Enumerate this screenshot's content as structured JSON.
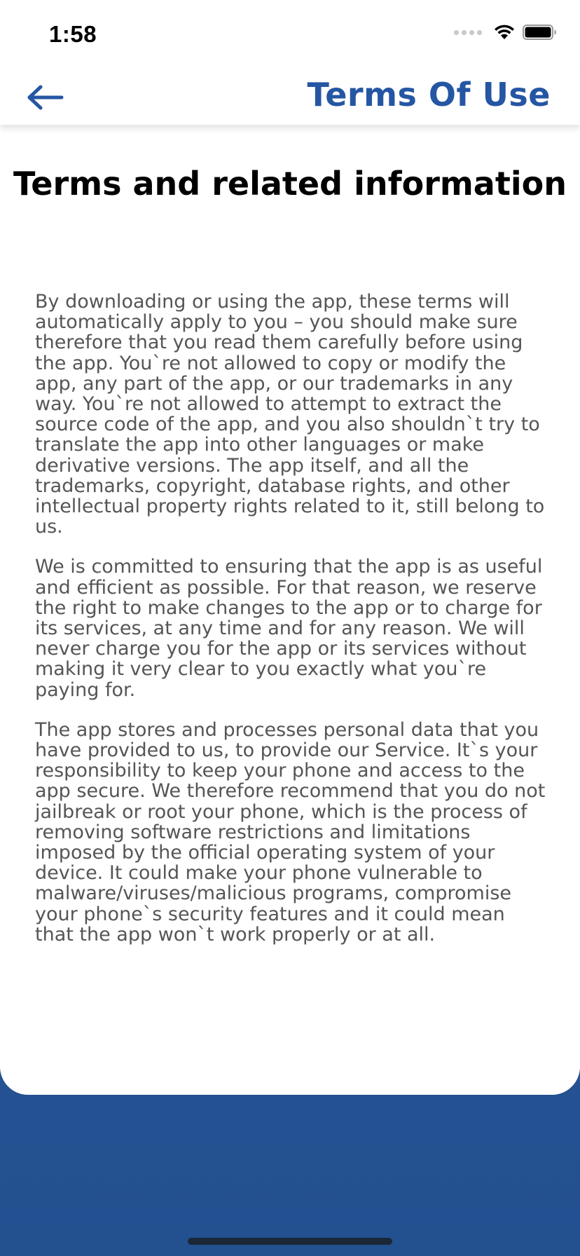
{
  "status_bar": {
    "time": "1:58"
  },
  "nav": {
    "title": "Terms Of Use",
    "back_icon": "arrow-left-icon"
  },
  "content": {
    "heading": "Terms and related information",
    "paragraphs": [
      "By downloading or using the app, these terms will automatically apply to you – you should make sure therefore that you read them carefully before using the app. You`re not allowed to copy or modify the app, any part of the app, or our trademarks in any way. You`re not allowed to attempt to extract the source code of the app, and you also shouldn`t try to translate the app into other languages or make derivative versions. The app itself, and all the trademarks, copyright, database rights, and other intellectual property rights related to it, still belong to us.",
      "We is committed to ensuring that the app is as useful and efficient as possible. For that reason, we reserve the right to make changes to the app or to charge for its services, at any time and for any reason. We will never charge you for the app or its services without making it very clear to you exactly what you`re paying for.",
      "The app stores and processes personal data that you have provided to us, to provide our Service. It`s your responsibility to keep your phone and access to the app secure. We therefore recommend that you do not jailbreak or root your phone, which is the process of removing software restrictions and limitations imposed by the official operating system of your device. It could make your phone vulnerable to malware/viruses/malicious programs, compromise your phone`s security features and it could mean that the app won`t work properly or at all."
    ]
  },
  "colors": {
    "accent": "#2556a4",
    "background_bottom": "#23508f",
    "body_text": "#555555"
  }
}
